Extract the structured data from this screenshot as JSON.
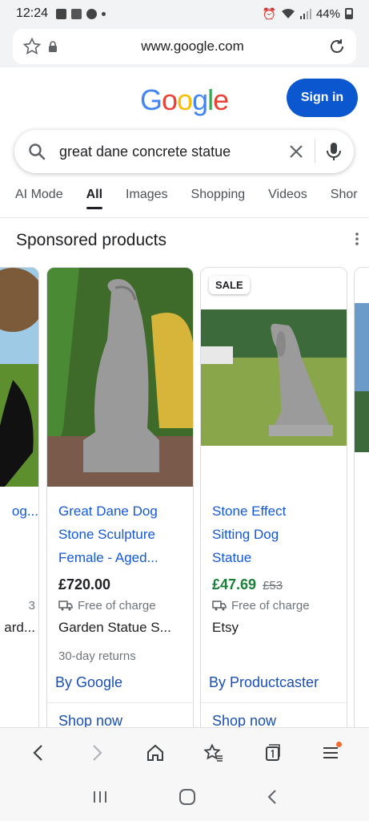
{
  "status": {
    "time": "12:24",
    "battery": "44%"
  },
  "browser": {
    "url": "www.google.com"
  },
  "google": {
    "logo_letters": [
      "G",
      "o",
      "o",
      "g",
      "l",
      "e"
    ],
    "signin_label": "Sign in"
  },
  "search": {
    "query": "great dane concrete statue"
  },
  "tabs": [
    {
      "label": "AI Mode",
      "active": false
    },
    {
      "label": "All",
      "active": true
    },
    {
      "label": "Images",
      "active": false
    },
    {
      "label": "Shopping",
      "active": false
    },
    {
      "label": "Videos",
      "active": false
    },
    {
      "label": "Shor",
      "active": false
    }
  ],
  "sponsored": {
    "title": "Sponsored products"
  },
  "products": [
    {
      "title_lines": [
        "",
        "",
        "og..."
      ],
      "price": "",
      "shipping": "3",
      "store": "ard...",
      "returns": "",
      "by": "",
      "shop": ""
    },
    {
      "title_lines": [
        "Great Dane Dog",
        "Stone Sculpture",
        "Female - Aged..."
      ],
      "price": "£720.00",
      "shipping": "Free of charge",
      "store": "Garden Statue S...",
      "returns": "30-day returns",
      "by": "By Google",
      "shop": "Shop now"
    },
    {
      "badge": "SALE",
      "title_lines": [
        "Stone Effect",
        "Sitting Dog",
        "Statue"
      ],
      "price": "£47.69",
      "old_price": "£53",
      "shipping": "Free of charge",
      "store": "Etsy",
      "returns": "",
      "by": "By Productcaster",
      "shop": "Shop now"
    }
  ],
  "colors": {
    "link": "#1558d6",
    "sale_price": "#188038",
    "signin_bg": "#0b57d0"
  }
}
